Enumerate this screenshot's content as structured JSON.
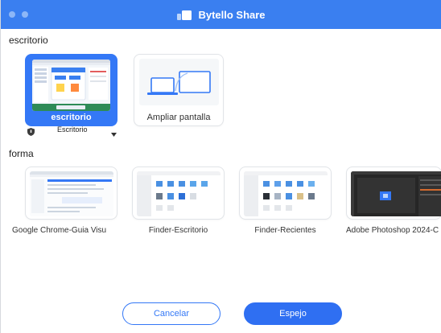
{
  "window": {
    "title": "Bytello Share"
  },
  "sections": {
    "desktop_title": "escritorio",
    "windows_title": "forma"
  },
  "desktop_cards": [
    {
      "label": "escritorio"
    },
    {
      "label": "Ampliar pantalla"
    }
  ],
  "desktop_select": {
    "value": "Escritorio"
  },
  "window_cards": [
    {
      "label": "Google Chrome-Guia Visu"
    },
    {
      "label": "Finder-Escritorio"
    },
    {
      "label": "Finder-Recientes"
    },
    {
      "label": "Adobe Photoshop 2024-C"
    }
  ],
  "buttons": {
    "cancel": "Cancelar",
    "confirm": "Espejo"
  },
  "colors": {
    "accent": "#3478f6",
    "titlebar": "#3a7ff0"
  },
  "icons": {
    "app": "bytello-share-icon",
    "shield": "shield-icon",
    "dropdown": "triangle-down-icon",
    "extend": "extend-screen-icon"
  }
}
